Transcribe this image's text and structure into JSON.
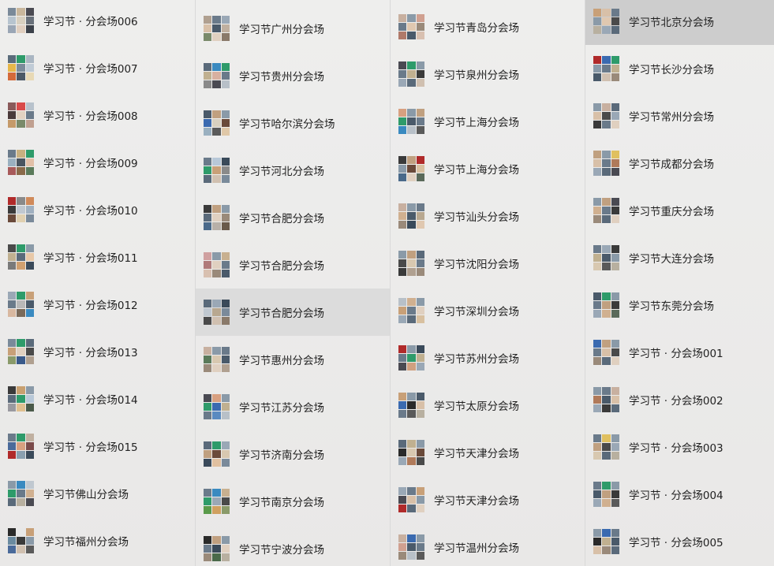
{
  "columns": [
    {
      "items": [
        {
          "name": "学习节 · 分会场006",
          "colors": [
            "#7a8a99",
            "#c9b79c",
            "#4a4a52",
            "#b7c4cf",
            "#d8d0c0",
            "#68707a",
            "#9aa6b5",
            "#e0cfc0",
            "#3b414a"
          ]
        },
        {
          "name": "学习节 · 分会场007",
          "colors": [
            "#5a6c7b",
            "#2e9b6a",
            "#aab6c2",
            "#e6b74a",
            "#7b8b9a",
            "#c0cbd6",
            "#d46a3a",
            "#4c5966",
            "#e8d9b5"
          ]
        },
        {
          "name": "学习节 · 分会场008",
          "colors": [
            "#8a5a5a",
            "#d94a4a",
            "#b8c2cc",
            "#4a3a3a",
            "#e2d2c2",
            "#6a7a8a",
            "#c59a6a",
            "#7a8a6a",
            "#c0a090"
          ]
        },
        {
          "name": "学习节 · 分会场009",
          "colors": [
            "#6a7a8a",
            "#c8b080",
            "#2e9b6a",
            "#9ab0c0",
            "#4a5560",
            "#e2c0a8",
            "#a85a5a",
            "#8a6a4a",
            "#5a7a5a"
          ]
        },
        {
          "name": "学习节 · 分会场010",
          "colors": [
            "#b02a2a",
            "#8a8a8a",
            "#d08a5a",
            "#3a3a3a",
            "#c0c8d0",
            "#a0b0c0",
            "#6a4a3a",
            "#e0d0b0",
            "#7a8a9a"
          ]
        },
        {
          "name": "学习节 · 分会场011",
          "colors": [
            "#4a4a4a",
            "#2e9b6a",
            "#8a9aa8",
            "#c0b090",
            "#5a6a7a",
            "#e8c8a8",
            "#7a7a7a",
            "#d0a070",
            "#3a4a5a"
          ]
        },
        {
          "name": "学习节 · 分会场012",
          "colors": [
            "#9aa8b6",
            "#2e9b6a",
            "#c8a078",
            "#6a7a8a",
            "#b8b8b8",
            "#4a5a6a",
            "#d8b8a0",
            "#7a6a5a",
            "#3a8ac0"
          ]
        },
        {
          "name": "学习节 · 分会场013",
          "colors": [
            "#7a8a9a",
            "#2e9b6a",
            "#5a6a7a",
            "#c8a078",
            "#e0d0c0",
            "#4a4a4a",
            "#8a9a6a",
            "#3a5a8a",
            "#b0a090"
          ]
        },
        {
          "name": "学习节 · 分会场014",
          "colors": [
            "#3a3a3a",
            "#c8a070",
            "#8a9aa8",
            "#5a6a7a",
            "#2e9b6a",
            "#b8c8d8",
            "#9a9aa0",
            "#e0c090",
            "#4a5a4a"
          ]
        },
        {
          "name": "学习节 · 分会场015",
          "colors": [
            "#6a7a8a",
            "#2e9b6a",
            "#c0b0a0",
            "#4a6a9a",
            "#d8a080",
            "#7a4a4a",
            "#b02a2a",
            "#8aa0b0",
            "#3a4a5a"
          ]
        },
        {
          "name": "学习节佛山分会场",
          "colors": [
            "#8a9aa8",
            "#3a8ac0",
            "#c0c8d0",
            "#2e9b6a",
            "#6a7a8a",
            "#d0b090",
            "#5a6a7a",
            "#b8b0a0",
            "#4a4a52"
          ]
        },
        {
          "name": "学习节福州分会场",
          "colors": [
            "#2a2a2a",
            "#e8e8e8",
            "#c8a078",
            "#6a8aa0",
            "#3a3a3a",
            "#8a9aa8",
            "#4a6a9a",
            "#d0c0b0",
            "#5a5a5a"
          ]
        }
      ]
    },
    {
      "items": [
        {
          "name": "学习节广州分会场",
          "colors": [
            "#b0a090",
            "#6a7a8a",
            "#9aa8b6",
            "#d8c0a8",
            "#4a5a6a",
            "#c0b0a0",
            "#7a8a6a",
            "#e0d0c0",
            "#8a7a6a"
          ]
        },
        {
          "name": "学习节贵州分会场",
          "colors": [
            "#5a6a7a",
            "#3a8ac0",
            "#2e9b6a",
            "#c0b090",
            "#d8b0a0",
            "#6a7a8a",
            "#8a8a8a",
            "#4a4a52",
            "#b8c0c8"
          ]
        },
        {
          "name": "学习节哈尔滨分会场",
          "colors": [
            "#4a5a6a",
            "#c0a080",
            "#8a9aa8",
            "#3a6ab0",
            "#d8d0c0",
            "#6a4a3a",
            "#9ab0c0",
            "#5a5a5a",
            "#e0c8a8"
          ]
        },
        {
          "name": "学习节河北分会场",
          "colors": [
            "#6a7a8a",
            "#b8c8d8",
            "#3a4a5a",
            "#2e9b6a",
            "#c8a078",
            "#8a8a8a",
            "#5a6a7a",
            "#d0c0b0",
            "#7a8a9a"
          ]
        },
        {
          "name": "学习节合肥分会场",
          "colors": [
            "#3a3a3a",
            "#c0a080",
            "#8a9aa8",
            "#5a6a7a",
            "#e0d0c0",
            "#9a8a7a",
            "#4a6a8a",
            "#b8b0a8",
            "#6a5a4a"
          ]
        },
        {
          "name": "学习节合肥分会场",
          "colors": [
            "#d0a0a0",
            "#8a9aa8",
            "#c8b090",
            "#b07a7a",
            "#e0d0c0",
            "#6a7a8a",
            "#d8c0b0",
            "#9a8a7a",
            "#4a5a6a"
          ]
        },
        {
          "name": "学习节合肥分会场",
          "colors": [
            "#5a6a7a",
            "#9aa8b6",
            "#3a4a5a",
            "#c0c8d0",
            "#b8a890",
            "#7a8a9a",
            "#4a4a4a",
            "#d0c0b0",
            "#8a7a6a"
          ]
        },
        {
          "name": "学习节惠州分会场",
          "colors": [
            "#c8b0a0",
            "#8a9aa8",
            "#6a7a8a",
            "#5a7a5a",
            "#d8c8b0",
            "#4a5a6a",
            "#9a8a7a",
            "#e0d0c0",
            "#b0a090"
          ]
        },
        {
          "name": "学习节江苏分会场",
          "colors": [
            "#4a4a52",
            "#d8a080",
            "#8a9aa8",
            "#2e9b6a",
            "#3a6ab0",
            "#c0b090",
            "#6a7a8a",
            "#5a8ac0",
            "#b8c0c8"
          ]
        },
        {
          "name": "学习节济南分会场",
          "colors": [
            "#5a6a7a",
            "#2e9b6a",
            "#9aa8b6",
            "#c0a080",
            "#6a4a3a",
            "#d8c8b0",
            "#3a4a5a",
            "#e0c0a0",
            "#7a8a9a"
          ]
        },
        {
          "name": "学习节南京分会场",
          "colors": [
            "#6a7a8a",
            "#3a8ac0",
            "#c8b090",
            "#2e9b6a",
            "#9aa8b6",
            "#4a4a4a",
            "#5a9a4a",
            "#d0a060",
            "#8a9a6a"
          ]
        },
        {
          "name": "学习节宁波分会场",
          "colors": [
            "#2a2a2a",
            "#c0a080",
            "#8a9aa8",
            "#6a7a8a",
            "#3a4a5a",
            "#e0d0c0",
            "#9a8a7a",
            "#4a6a4a",
            "#b8b0a0"
          ]
        }
      ]
    },
    {
      "items": [
        {
          "name": "学习节青岛分会场",
          "colors": [
            "#c8b0a0",
            "#8a9aa8",
            "#d0a090",
            "#6a7a8a",
            "#e0c8b0",
            "#9a8a7a",
            "#b07a6a",
            "#4a5a6a",
            "#d8c0b0"
          ]
        },
        {
          "name": "学习节泉州分会场",
          "colors": [
            "#4a4a52",
            "#2e9b6a",
            "#8a9aa8",
            "#6a7a8a",
            "#c0b090",
            "#3a3a3a",
            "#9aa8b6",
            "#5a6a7a",
            "#d0c0b0"
          ]
        },
        {
          "name": "学习节上海分会场",
          "colors": [
            "#d8a080",
            "#8a9aa8",
            "#c0a080",
            "#2e9b6a",
            "#4a5a6a",
            "#6a7a8a",
            "#3a8ac0",
            "#b8c0c8",
            "#5a5a5a"
          ]
        },
        {
          "name": "学习节上海分会场",
          "colors": [
            "#3a3a3a",
            "#c0a080",
            "#b02a2a",
            "#8a9aa8",
            "#6a4a3a",
            "#d8c0a0",
            "#4a6a8a",
            "#e0d0c0",
            "#5a6a5a"
          ]
        },
        {
          "name": "学习节汕头分会场",
          "colors": [
            "#c8b0a0",
            "#8a9aa8",
            "#6a7a8a",
            "#d0b090",
            "#4a5a6a",
            "#b8a890",
            "#9a8a7a",
            "#3a4a5a",
            "#e0c8b0"
          ]
        },
        {
          "name": "学习节沈阳分会场",
          "colors": [
            "#8a9aa8",
            "#c0a080",
            "#5a6a7a",
            "#4a4a4a",
            "#d8c8b0",
            "#6a7a8a",
            "#3a3a3a",
            "#b0a090",
            "#9a8a7a"
          ]
        },
        {
          "name": "学习节深圳分会场",
          "colors": [
            "#b8c0c8",
            "#d0b090",
            "#8a9aa8",
            "#c8a078",
            "#6a7a8a",
            "#e0d0c0",
            "#9aa8b6",
            "#5a6a7a",
            "#d8c0a0"
          ]
        },
        {
          "name": "学习节苏州分会场",
          "colors": [
            "#b02a2a",
            "#8a9aa8",
            "#3a4a5a",
            "#6a7a8a",
            "#2e9b6a",
            "#c0b090",
            "#4a4a52",
            "#d0a080",
            "#9aa8b6"
          ]
        },
        {
          "name": "学习节太原分会场",
          "colors": [
            "#c8a078",
            "#8a9aa8",
            "#4a5a6a",
            "#3a6ab0",
            "#2a2a2a",
            "#d8c0a8",
            "#6a7a8a",
            "#5a5a5a",
            "#b8b0a0"
          ]
        },
        {
          "name": "学习节天津分会场",
          "colors": [
            "#5a6a7a",
            "#c0b090",
            "#8a9aa8",
            "#2a2a2a",
            "#d8c8b0",
            "#6a4a3a",
            "#9aa8b6",
            "#b07a5a",
            "#4a4a4a"
          ]
        },
        {
          "name": "学习节天津分会场",
          "colors": [
            "#9aa8b6",
            "#6a7a8a",
            "#c8a078",
            "#4a4a52",
            "#d8c0a8",
            "#8a9aa8",
            "#b02a2a",
            "#5a6a7a",
            "#e0d0c0"
          ]
        },
        {
          "name": "学习节温州分会场",
          "colors": [
            "#c8b0a0",
            "#3a6ab0",
            "#8a9aa8",
            "#d0a090",
            "#4a5a6a",
            "#6a7a8a",
            "#9a8a7a",
            "#b8c0c8",
            "#5a5a5a"
          ]
        }
      ]
    },
    {
      "items": [
        {
          "name": "学习节北京分会场",
          "selected": true,
          "colors": [
            "#c8a078",
            "#d8c0a8",
            "#6a7a8a",
            "#8a9aa8",
            "#e0c8b0",
            "#4a4a4a",
            "#b8b0a0",
            "#9aa8b6",
            "#5a6a7a"
          ]
        },
        {
          "name": "学习节长沙分会场",
          "colors": [
            "#b02a2a",
            "#3a6ab0",
            "#2e9b6a",
            "#8a9aa8",
            "#6a7a8a",
            "#c0b090",
            "#4a5a6a",
            "#d0c0b0",
            "#9a8a7a"
          ]
        },
        {
          "name": "学习节常州分会场",
          "colors": [
            "#8a9aa8",
            "#c8b0a0",
            "#5a6a7a",
            "#d8c0a8",
            "#4a4a4a",
            "#9aa8b6",
            "#3a3a3a",
            "#6a7a8a",
            "#e0d0c0"
          ]
        },
        {
          "name": "学习节成都分会场",
          "colors": [
            "#c0a080",
            "#8a9aa8",
            "#e0c060",
            "#d8c0a8",
            "#6a7a8a",
            "#b07a5a",
            "#9aa8b6",
            "#5a6a7a",
            "#4a4a52"
          ]
        },
        {
          "name": "学习节重庆分会场",
          "colors": [
            "#8a9aa8",
            "#c0a080",
            "#4a4a52",
            "#d0b090",
            "#6a7a8a",
            "#3a3a3a",
            "#9a8a7a",
            "#5a6a7a",
            "#e0d0c0"
          ]
        },
        {
          "name": "学习节大连分会场",
          "colors": [
            "#6a7a8a",
            "#9aa8b6",
            "#3a3a3a",
            "#c0b090",
            "#4a5a6a",
            "#8a9aa8",
            "#d8c8b0",
            "#5a5a5a",
            "#b8b0a0"
          ]
        },
        {
          "name": "学习节东莞分会场",
          "colors": [
            "#4a5a6a",
            "#2e9b6a",
            "#8a9aa8",
            "#6a7a8a",
            "#c0a080",
            "#3a3a3a",
            "#9aa8b6",
            "#d0b090",
            "#5a6a5a"
          ]
        },
        {
          "name": "学习节 · 分会场001",
          "colors": [
            "#3a6ab0",
            "#c0a080",
            "#8a9aa8",
            "#6a7a8a",
            "#d8c0a8",
            "#4a4a4a",
            "#9a8a7a",
            "#5a6a7a",
            "#e0d0c0"
          ]
        },
        {
          "name": "学习节 · 分会场002",
          "colors": [
            "#8a9aa8",
            "#6a7a8a",
            "#c8b0a0",
            "#b07a5a",
            "#4a5a6a",
            "#d8c0a8",
            "#9aa8b6",
            "#3a3a3a",
            "#5a6a7a"
          ]
        },
        {
          "name": "学习节 · 分会场003",
          "colors": [
            "#6a7a8a",
            "#e0c060",
            "#8a9aa8",
            "#c0a080",
            "#4a4a4a",
            "#9aa8b6",
            "#d8c8b0",
            "#5a6a7a",
            "#b8b0a0"
          ]
        },
        {
          "name": "学习节 · 分会场004",
          "colors": [
            "#6a7a8a",
            "#2e9b6a",
            "#8a9aa8",
            "#4a5a6a",
            "#c0a080",
            "#3a3a3a",
            "#9aa8b6",
            "#d0b090",
            "#5a5a5a"
          ]
        },
        {
          "name": "学习节 · 分会场005",
          "colors": [
            "#8a9aa8",
            "#3a6ab0",
            "#6a7a8a",
            "#2a2a2a",
            "#c0b090",
            "#4a5a6a",
            "#d8c0a8",
            "#9a8a7a",
            "#5a6a7a"
          ]
        }
      ]
    }
  ],
  "highlighted": {
    "column": 1,
    "row": 6
  }
}
